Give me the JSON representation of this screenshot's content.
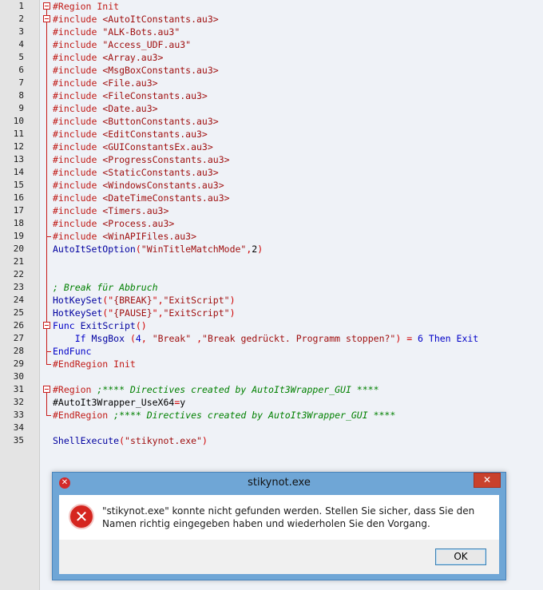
{
  "editor": {
    "lines": [
      {
        "n": "1",
        "tokens": [
          {
            "c": "dir",
            "t": "#Region Init"
          }
        ]
      },
      {
        "n": "2",
        "tokens": [
          {
            "c": "dir",
            "t": "#include "
          },
          {
            "c": "str",
            "t": "<AutoItConstants.au3>"
          }
        ]
      },
      {
        "n": "3",
        "tokens": [
          {
            "c": "dir",
            "t": "#include "
          },
          {
            "c": "str",
            "t": "\"ALK-Bots.au3\""
          }
        ]
      },
      {
        "n": "4",
        "tokens": [
          {
            "c": "dir",
            "t": "#include "
          },
          {
            "c": "str",
            "t": "\"Access_UDF.au3\""
          }
        ]
      },
      {
        "n": "5",
        "tokens": [
          {
            "c": "dir",
            "t": "#include "
          },
          {
            "c": "str",
            "t": "<Array.au3>"
          }
        ]
      },
      {
        "n": "6",
        "tokens": [
          {
            "c": "dir",
            "t": "#include "
          },
          {
            "c": "str",
            "t": "<MsgBoxConstants.au3>"
          }
        ]
      },
      {
        "n": "7",
        "tokens": [
          {
            "c": "dir",
            "t": "#include "
          },
          {
            "c": "str",
            "t": "<File.au3>"
          }
        ]
      },
      {
        "n": "8",
        "tokens": [
          {
            "c": "dir",
            "t": "#include "
          },
          {
            "c": "str",
            "t": "<FileConstants.au3>"
          }
        ]
      },
      {
        "n": "9",
        "tokens": [
          {
            "c": "dir",
            "t": "#include "
          },
          {
            "c": "str",
            "t": "<Date.au3>"
          }
        ]
      },
      {
        "n": "10",
        "tokens": [
          {
            "c": "dir",
            "t": "#include "
          },
          {
            "c": "str",
            "t": "<ButtonConstants.au3>"
          }
        ]
      },
      {
        "n": "11",
        "tokens": [
          {
            "c": "dir",
            "t": "#include "
          },
          {
            "c": "str",
            "t": "<EditConstants.au3>"
          }
        ]
      },
      {
        "n": "12",
        "tokens": [
          {
            "c": "dir",
            "t": "#include "
          },
          {
            "c": "str",
            "t": "<GUIConstantsEx.au3>"
          }
        ]
      },
      {
        "n": "13",
        "tokens": [
          {
            "c": "dir",
            "t": "#include "
          },
          {
            "c": "str",
            "t": "<ProgressConstants.au3>"
          }
        ]
      },
      {
        "n": "14",
        "tokens": [
          {
            "c": "dir",
            "t": "#include "
          },
          {
            "c": "str",
            "t": "<StaticConstants.au3>"
          }
        ]
      },
      {
        "n": "15",
        "tokens": [
          {
            "c": "dir",
            "t": "#include "
          },
          {
            "c": "str",
            "t": "<WindowsConstants.au3>"
          }
        ]
      },
      {
        "n": "16",
        "tokens": [
          {
            "c": "dir",
            "t": "#include "
          },
          {
            "c": "str",
            "t": "<DateTimeConstants.au3>"
          }
        ]
      },
      {
        "n": "17",
        "tokens": [
          {
            "c": "dir",
            "t": "#include "
          },
          {
            "c": "str",
            "t": "<Timers.au3>"
          }
        ]
      },
      {
        "n": "18",
        "tokens": [
          {
            "c": "dir",
            "t": "#include "
          },
          {
            "c": "str",
            "t": "<Process.au3>"
          }
        ]
      },
      {
        "n": "19",
        "tokens": [
          {
            "c": "dir",
            "t": "#include "
          },
          {
            "c": "str",
            "t": "<WinAPIFiles.au3>"
          }
        ]
      },
      {
        "n": "20",
        "tokens": [
          {
            "c": "fn",
            "t": "AutoItSetOption"
          },
          {
            "c": "op",
            "t": "("
          },
          {
            "c": "str",
            "t": "\"WinTitleMatchMode\""
          },
          {
            "c": "op",
            "t": ","
          },
          {
            "c": "plain",
            "t": "2"
          },
          {
            "c": "op",
            "t": ")"
          }
        ]
      },
      {
        "n": "21",
        "tokens": []
      },
      {
        "n": "22",
        "tokens": []
      },
      {
        "n": "23",
        "tokens": [
          {
            "c": "cm",
            "t": "; Break für Abbruch"
          }
        ]
      },
      {
        "n": "24",
        "tokens": [
          {
            "c": "fn",
            "t": "HotKeySet"
          },
          {
            "c": "op",
            "t": "(\""
          },
          {
            "c": "str",
            "t": "{BREAK}"
          },
          {
            "c": "op",
            "t": "\","
          },
          {
            "c": "str",
            "t": "\"ExitScript\""
          },
          {
            "c": "op",
            "t": ")"
          }
        ]
      },
      {
        "n": "25",
        "tokens": [
          {
            "c": "fn",
            "t": "HotKeySet"
          },
          {
            "c": "op",
            "t": "(\""
          },
          {
            "c": "str",
            "t": "{PAUSE}"
          },
          {
            "c": "op",
            "t": "\","
          },
          {
            "c": "str",
            "t": "\"ExitScript\""
          },
          {
            "c": "op",
            "t": ")"
          }
        ]
      },
      {
        "n": "26",
        "tokens": [
          {
            "c": "kw",
            "t": "Func "
          },
          {
            "c": "fn",
            "t": "ExitScript"
          },
          {
            "c": "op",
            "t": "()"
          }
        ]
      },
      {
        "n": "27",
        "tokens": [
          {
            "c": "plain",
            "t": "    "
          },
          {
            "c": "kw",
            "t": "If "
          },
          {
            "c": "fn",
            "t": "MsgBox "
          },
          {
            "c": "op",
            "t": "("
          },
          {
            "c": "num",
            "t": "4"
          },
          {
            "c": "op",
            "t": ", "
          },
          {
            "c": "str",
            "t": "\"Break\""
          },
          {
            "c": "op",
            "t": " ,"
          },
          {
            "c": "str",
            "t": "\"Break gedrückt. Programm stoppen?\""
          },
          {
            "c": "op",
            "t": ") = "
          },
          {
            "c": "num",
            "t": "6 "
          },
          {
            "c": "kw",
            "t": "Then Exit"
          }
        ]
      },
      {
        "n": "28",
        "tokens": [
          {
            "c": "kw",
            "t": "EndFunc"
          }
        ]
      },
      {
        "n": "29",
        "tokens": [
          {
            "c": "dir",
            "t": "#EndRegion Init"
          }
        ]
      },
      {
        "n": "30",
        "tokens": []
      },
      {
        "n": "31",
        "tokens": [
          {
            "c": "dir",
            "t": "#Region "
          },
          {
            "c": "cm",
            "t": ";**** Directives created by AutoIt3Wrapper_GUI ****"
          }
        ]
      },
      {
        "n": "32",
        "tokens": [
          {
            "c": "plain",
            "t": "#AutoIt3Wrapper_UseX64"
          },
          {
            "c": "op",
            "t": "="
          },
          {
            "c": "plain",
            "t": "y"
          }
        ]
      },
      {
        "n": "33",
        "tokens": [
          {
            "c": "dir",
            "t": "#EndRegion "
          },
          {
            "c": "cm",
            "t": ";**** Directives created by AutoIt3Wrapper_GUI ****"
          }
        ]
      },
      {
        "n": "34",
        "tokens": []
      },
      {
        "n": "35",
        "tokens": [
          {
            "c": "fn",
            "t": "ShellExecute"
          },
          {
            "c": "op",
            "t": "("
          },
          {
            "c": "str",
            "t": "\"stikynot.exe\""
          },
          {
            "c": "op",
            "t": ")"
          }
        ]
      }
    ]
  },
  "dialog": {
    "title": "stikynot.exe",
    "message": "\"stikynot.exe\" konnte nicht gefunden werden. Stellen Sie sicher, dass Sie den Namen richtig eingegeben haben und wiederholen Sie den Vorgang.",
    "ok_label": "OK",
    "close_glyph": "✕",
    "app_icon_glyph": "✕",
    "error_icon_glyph": "✕"
  },
  "colors": {
    "directive": "#c11b17",
    "string": "#a01010",
    "comment": "#008000",
    "keyword": "#0000c8",
    "fold_marker": "#c81a1a",
    "dialog_frame": "#6fa6d6",
    "close_button": "#c9412c"
  }
}
